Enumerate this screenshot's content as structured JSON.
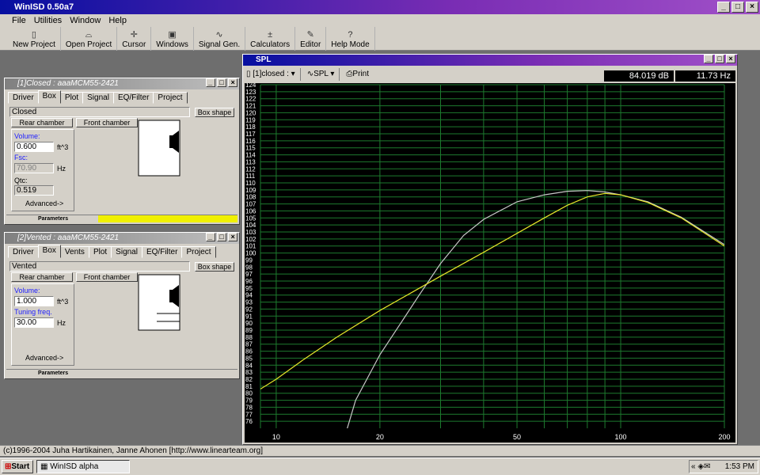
{
  "app": {
    "title": "WinISD 0.50a7",
    "menu": [
      "File",
      "Utilities",
      "Window",
      "Help"
    ],
    "toolbar": [
      {
        "label": "New Project",
        "icon": "new-project-icon",
        "glyph": "▯"
      },
      {
        "label": "Open Project",
        "icon": "open-project-icon",
        "glyph": "⌓"
      },
      {
        "label": "Cursor",
        "icon": "cursor-icon",
        "glyph": "✛"
      },
      {
        "label": "Windows",
        "icon": "windows-icon",
        "glyph": "▣"
      },
      {
        "label": "Signal Gen.",
        "icon": "signal-gen-icon",
        "glyph": "∿"
      },
      {
        "label": "Calculators",
        "icon": "calculators-icon",
        "glyph": "±"
      },
      {
        "label": "Editor",
        "icon": "editor-icon",
        "glyph": "✎"
      },
      {
        "label": "Help Mode",
        "icon": "help-mode-icon",
        "glyph": "?"
      }
    ]
  },
  "closed": {
    "title": "[1]Closed : aaaMCM55-2421",
    "tabs": [
      "Driver",
      "Box",
      "Plot",
      "Signal",
      "EQ/Filter",
      "Project"
    ],
    "type": "Closed",
    "box_shape": "Box shape",
    "rear": "Rear chamber",
    "front": "Front chamber",
    "volume_label": "Volume:",
    "volume": "0.600",
    "volume_unit": "ft^3",
    "fsc_label": "Fsc:",
    "fsc": "70.90",
    "fsc_unit": "Hz",
    "qtc_label": "Qtc:",
    "qtc": "0.519",
    "advanced": "Advanced->",
    "params": "Parameters"
  },
  "vented": {
    "title": "[2]Vented : aaaMCM55-2421",
    "tabs": [
      "Driver",
      "Box",
      "Vents",
      "Plot",
      "Signal",
      "EQ/Filter",
      "Project"
    ],
    "type": "Vented",
    "box_shape": "Box shape",
    "rear": "Rear chamber",
    "front": "Front chamber",
    "volume_label": "Volume:",
    "volume": "1.000",
    "volume_unit": "ft^3",
    "tuning_label": "Tuning freq.",
    "tuning": "30.00",
    "tuning_unit": "Hz",
    "advanced": "Advanced->",
    "params": "Parameters"
  },
  "spl": {
    "title": "SPL",
    "project_select": "[1]closed :",
    "graph_select": "SPL",
    "print": "Print",
    "readout_db": "84.019 dB",
    "readout_hz": "11.73 Hz"
  },
  "chart_data": {
    "type": "line",
    "xlabel": "",
    "ylabel": "",
    "xscale": "log",
    "xlim": [
      9,
      200
    ],
    "ylim": [
      75,
      124
    ],
    "x_ticks": [
      10,
      20,
      50,
      100,
      200
    ],
    "y_ticks": [
      76,
      77,
      78,
      79,
      80,
      81,
      82,
      83,
      84,
      85,
      86,
      87,
      88,
      89,
      90,
      91,
      92,
      93,
      94,
      95,
      96,
      97,
      98,
      99,
      100,
      101,
      102,
      103,
      104,
      105,
      106,
      107,
      108,
      109,
      110,
      111,
      112,
      113,
      114,
      115,
      116,
      117,
      118,
      119,
      120,
      121,
      122,
      123,
      124
    ],
    "series": [
      {
        "color": "#e6e62a",
        "x": [
          9,
          10,
          12,
          15,
          20,
          25,
          30,
          40,
          50,
          60,
          70,
          80,
          90,
          100,
          120,
          150,
          200
        ],
        "y": [
          80.6,
          82,
          84.8,
          88,
          91.8,
          94.5,
          96.7,
          100.1,
          102.8,
          105,
          106.8,
          108,
          108.5,
          108.3,
          107.2,
          105,
          101
        ]
      },
      {
        "color": "#c8c8c8",
        "x": [
          15,
          17,
          20,
          23,
          26,
          30,
          35,
          40,
          50,
          60,
          70,
          80,
          90,
          100,
          120,
          150,
          200
        ],
        "y": [
          70,
          79,
          85.5,
          90,
          94,
          98.5,
          102.5,
          104.8,
          107.3,
          108.3,
          108.8,
          108.9,
          108.7,
          108.3,
          107.3,
          105.1,
          101.2
        ]
      }
    ]
  },
  "status": "(c)1996-2004 Juha Hartikainen, Janne Ahonen [http://www.linearteam.org]",
  "taskbar": {
    "start": "Start",
    "task": "WinISD alpha",
    "clock": "1:53 PM"
  }
}
